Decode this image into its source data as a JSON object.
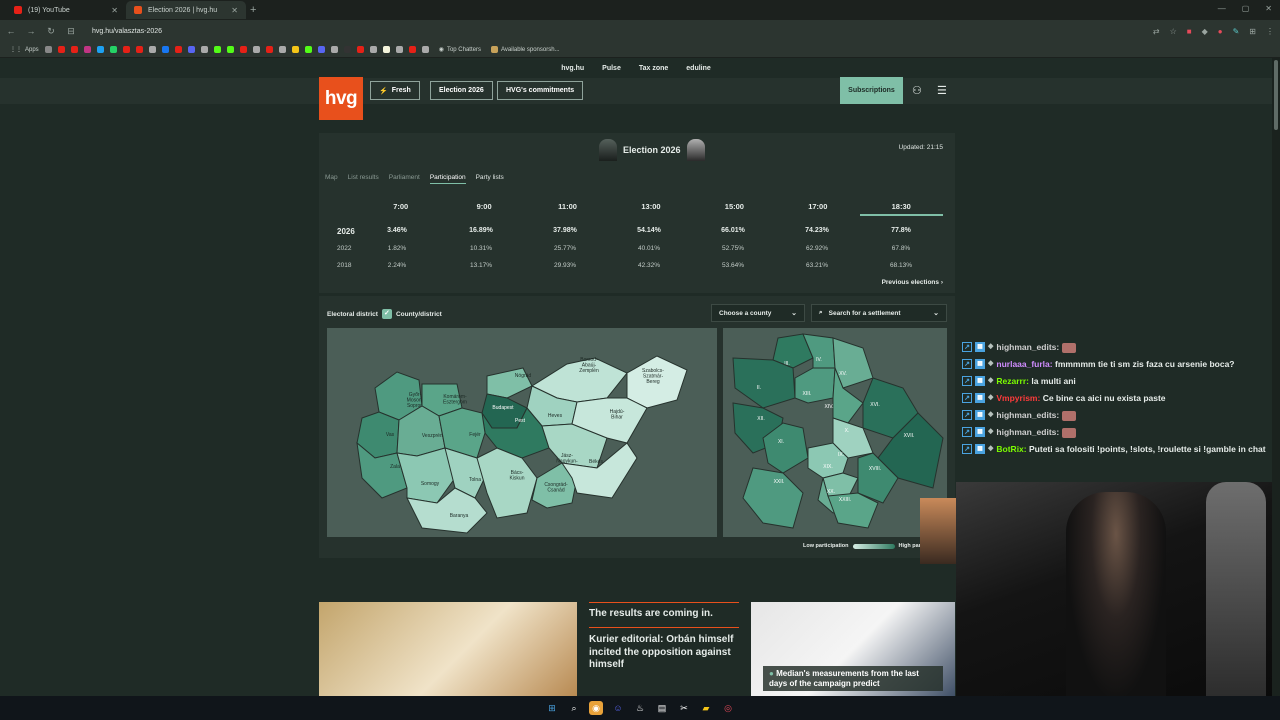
{
  "browser": {
    "tabs": [
      {
        "title": "(19) YouTube",
        "active": false,
        "color": "#e62117"
      },
      {
        "title": "Election 2026 | hvg.hu",
        "active": true,
        "color": "#e8501c"
      }
    ],
    "url": "hvg.hu/valasztas-2026",
    "bookmarks": {
      "apps": "Apps",
      "top_chatters": "Top Chatters",
      "available_sponsors": "Available sponsorsh..."
    }
  },
  "site": {
    "topnav": [
      "hvg.hu",
      "Pulse",
      "Tax zone",
      "eduline"
    ],
    "logo": "hvg",
    "buttons": {
      "fresh": "Fresh",
      "election": "Election 2026",
      "commitments": "HVG's commitments",
      "subscriptions": "Subscriptions"
    }
  },
  "election": {
    "title": "Election 2026",
    "updated": "Updated: 21:15",
    "tabs": [
      "Map",
      "List results",
      "Parliament",
      "Participation",
      "Party lists"
    ],
    "active_tab": "Participation",
    "times": [
      "7:00",
      "9:00",
      "11:00",
      "13:00",
      "15:00",
      "17:00",
      "18:30"
    ],
    "rows": [
      {
        "year": "2026",
        "values": [
          "3.46%",
          "16.89%",
          "37.98%",
          "54.14%",
          "66.01%",
          "74.23%",
          "77.8%"
        ]
      },
      {
        "year": "2022",
        "values": [
          "1.82%",
          "10.31%",
          "25.77%",
          "40.01%",
          "52.75%",
          "62.92%",
          "67.8%"
        ]
      },
      {
        "year": "2018",
        "values": [
          "2.24%",
          "13.17%",
          "29.93%",
          "42.32%",
          "53.64%",
          "63.21%",
          "68.13%"
        ]
      }
    ],
    "previous": "Previous elections"
  },
  "map": {
    "electoral_district": "Electoral district",
    "county_district": "County/district",
    "choose_county": "Choose a county",
    "search_settlement": "Search for a settlement",
    "legend_low": "Low participation",
    "legend_high": "High part",
    "counties": [
      {
        "name": "Győr-\nMoson-\nSopron",
        "fill": "#4f9a80"
      },
      {
        "name": "Komárom-\nEsztergom",
        "fill": "#5aa589"
      },
      {
        "name": "Nógrád",
        "fill": "#7fbfa7"
      },
      {
        "name": "Borsod-\nAbaúj-\nZemplén",
        "fill": "#bfe3d6"
      },
      {
        "name": "Szabolcs-\nSzatmár-\nBereg",
        "fill": "#d4ede4"
      },
      {
        "name": "Heves",
        "fill": "#9fd2c0"
      },
      {
        "name": "Budapest",
        "fill": "#236652"
      },
      {
        "name": "Pest",
        "fill": "#2f7a60"
      },
      {
        "name": "Vas",
        "fill": "#3e8a70"
      },
      {
        "name": "Veszprém",
        "fill": "#69ad94"
      },
      {
        "name": "Fejér",
        "fill": "#5aa589"
      },
      {
        "name": "Jász-\nNagykun-\nSzolnok",
        "fill": "#a8d7c5"
      },
      {
        "name": "Hajdú-\nBihar",
        "fill": "#c7e7db"
      },
      {
        "name": "Zala",
        "fill": "#4f9a80"
      },
      {
        "name": "Somogy",
        "fill": "#8cc8b3"
      },
      {
        "name": "Tolna",
        "fill": "#9fd2c0"
      },
      {
        "name": "Bács-\nKiskun",
        "fill": "#a8d7c5"
      },
      {
        "name": "Csongrád-\nCsanád",
        "fill": "#7fbfa7"
      },
      {
        "name": "Békés",
        "fill": "#c7e7db"
      },
      {
        "name": "Baranya",
        "fill": "#b5ddcf"
      }
    ],
    "districts": [
      {
        "name": "III.",
        "fill": "#2f7a60"
      },
      {
        "name": "IV.",
        "fill": "#4f9a80"
      },
      {
        "name": "XV.",
        "fill": "#69ad94"
      },
      {
        "name": "II.",
        "fill": "#2a705a"
      },
      {
        "name": "XIII.",
        "fill": "#4f9a80"
      },
      {
        "name": "XIV.",
        "fill": "#5aa589"
      },
      {
        "name": "XVI.",
        "fill": "#2a705a"
      },
      {
        "name": "XII.",
        "fill": "#2a705a"
      },
      {
        "name": "X.",
        "fill": "#9fd2c0"
      },
      {
        "name": "XVII.",
        "fill": "#236652"
      },
      {
        "name": "XI.",
        "fill": "#3e8a70"
      },
      {
        "name": "IX.",
        "fill": "#8cc8b3"
      },
      {
        "name": "XIX.",
        "fill": "#7fbfa7"
      },
      {
        "name": "XVIII.",
        "fill": "#3e8a70"
      },
      {
        "name": "XXII.",
        "fill": "#4f9a80"
      },
      {
        "name": "XX.",
        "fill": "#69ad94"
      },
      {
        "name": "XXIII.",
        "fill": "#5aa589"
      }
    ]
  },
  "news": {
    "headline1": "The results are coming in.",
    "headline2": "Kurier editorial: Orbán himself incited the opposition against himself",
    "caption": "Median's measurements from the last days of the campaign predict"
  },
  "chat": [
    {
      "user": "highman_edits:",
      "color": "#cfcfcf",
      "text": "",
      "emote": true
    },
    {
      "user": "nurlaaa_furla:",
      "color": "#d08cff",
      "text": "fmmmmm tie ti sm zis faza cu arsenie boca?",
      "emote": false
    },
    {
      "user": "Rezarrr:",
      "color": "#7cfc00",
      "text": "la multi ani",
      "emote": false
    },
    {
      "user": "Vmpyrism:",
      "color": "#ff3b3b",
      "text": "Ce bine ca aici nu exista paste",
      "emote": false
    },
    {
      "user": "highman_edits:",
      "color": "#cfcfcf",
      "text": "",
      "emote": true
    },
    {
      "user": "highman_edits:",
      "color": "#cfcfcf",
      "text": "",
      "emote": true
    },
    {
      "user": "BotRix:",
      "color": "#7cfc00",
      "text": "Puteti sa folositi !points, !slots, !roulette si !gamble in chat",
      "emote": false
    }
  ]
}
